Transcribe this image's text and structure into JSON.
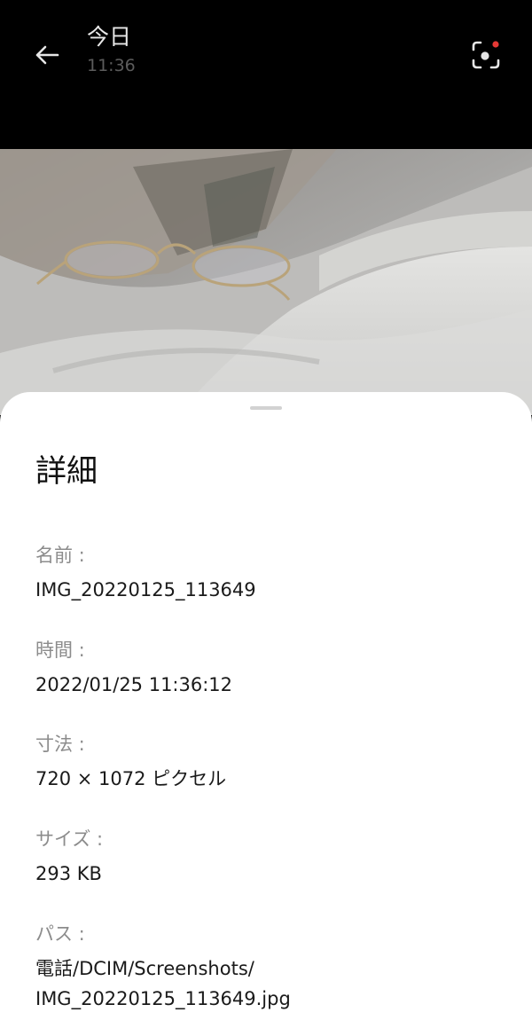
{
  "header": {
    "back_icon": "arrow-left-icon",
    "title": "今日",
    "subtitle": "11:36",
    "lens_icon": "google-lens-icon"
  },
  "details": {
    "title": "詳細",
    "items": [
      {
        "label": "名前 :",
        "value": "IMG_20220125_113649"
      },
      {
        "label": "時間 :",
        "value": "2022/01/25 11:36:12"
      },
      {
        "label": "寸法 :",
        "value": "720 × 1072 ピクセル"
      },
      {
        "label": "サイズ :",
        "value": "293 KB"
      },
      {
        "label": "パス :",
        "value_line1": "電話/DCIM/Screenshots/",
        "value_line2": "IMG_20220125_113649.jpg"
      }
    ]
  },
  "colors": {
    "background": "#000000",
    "sheet": "#ffffff",
    "label": "#8c8c8c",
    "value": "#1a1a1a",
    "lens_dot": "#e53935"
  }
}
